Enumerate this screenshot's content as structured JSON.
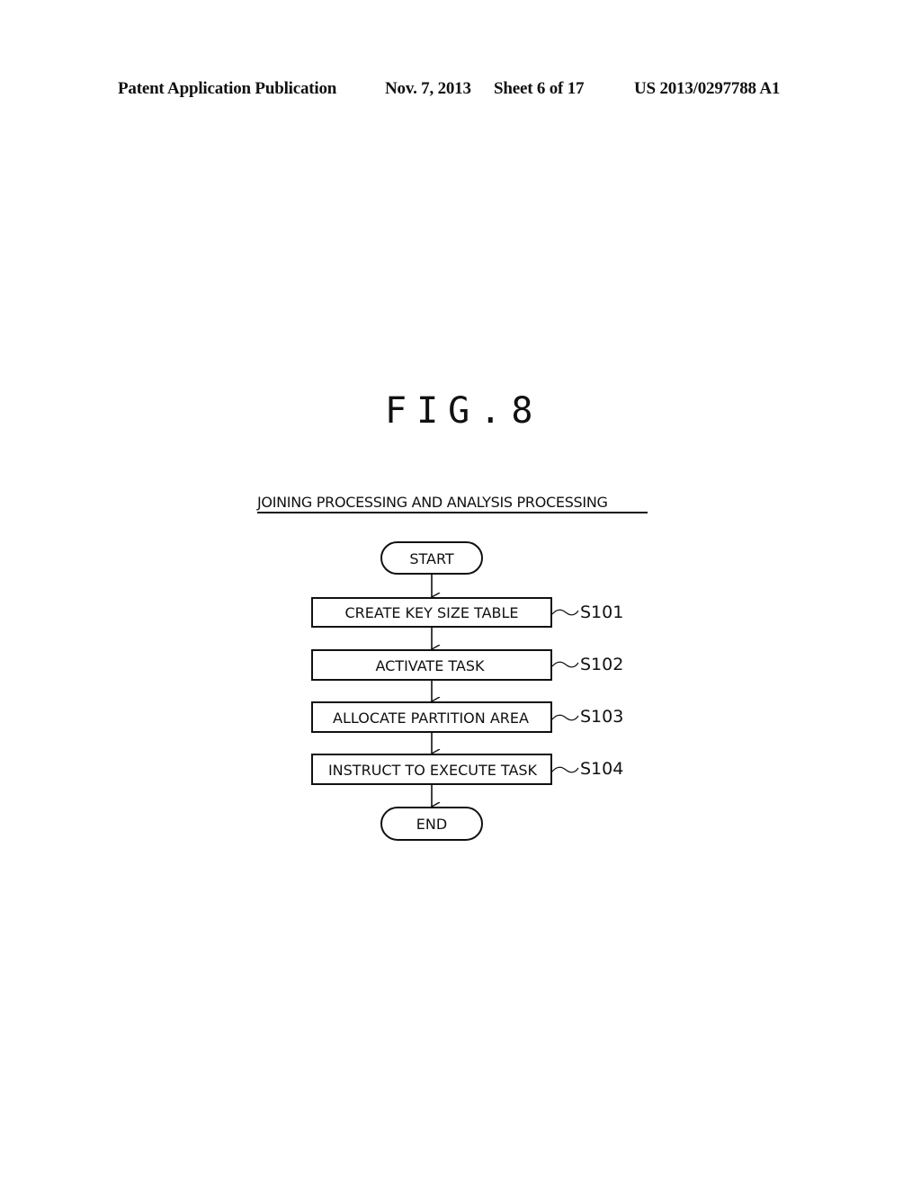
{
  "header": {
    "publication": "Patent Application Publication",
    "date": "Nov. 7, 2013",
    "sheet": "Sheet 6 of 17",
    "number": "US 2013/0297788 A1"
  },
  "figure": {
    "label": "FIG.8",
    "title": "JOINING PROCESSING AND ANALYSIS PROCESSING"
  },
  "flowchart": {
    "start": "START",
    "end": "END",
    "steps": [
      {
        "id": "S101",
        "text": "CREATE KEY SIZE TABLE"
      },
      {
        "id": "S102",
        "text": "ACTIVATE TASK"
      },
      {
        "id": "S103",
        "text": "ALLOCATE PARTITION AREA"
      },
      {
        "id": "S104",
        "text": "INSTRUCT TO EXECUTE TASK"
      }
    ]
  }
}
